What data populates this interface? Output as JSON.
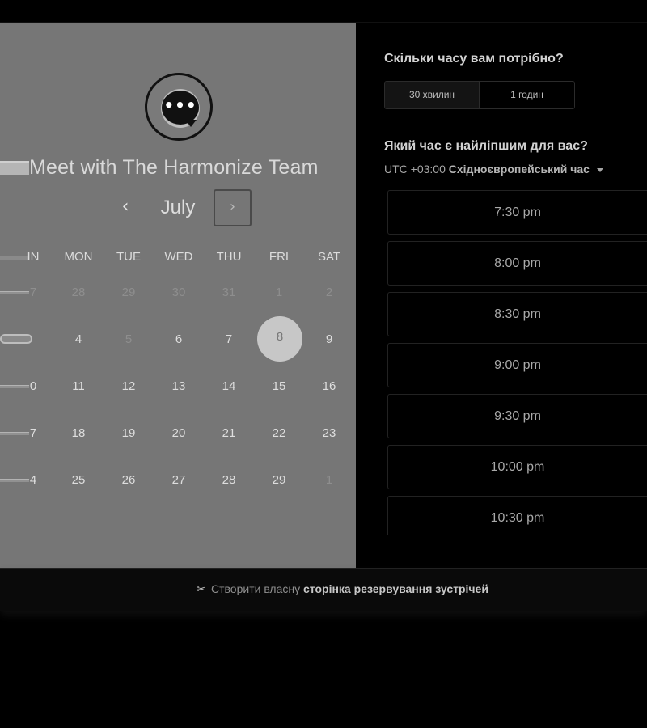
{
  "meeting": {
    "title": "Meet with The Harmonize Team",
    "logo_icon": "chat-bubble-ellipsis-icon"
  },
  "calendar": {
    "month": "July",
    "prev_label": "‹",
    "next_label": "›",
    "weekdays": [
      "SUN",
      "MON",
      "TUE",
      "WED",
      "THU",
      "FRI",
      "SAT"
    ],
    "weekdays_visible": [
      "IN",
      "MON",
      "TUE",
      "WED",
      "THU",
      "FRI",
      "SAT"
    ],
    "rows": [
      [
        "7",
        "28",
        "29",
        "30",
        "31",
        "1",
        "2"
      ],
      [
        "",
        "4",
        "5",
        "6",
        "7",
        "8",
        "9"
      ],
      [
        "0",
        "11",
        "12",
        "13",
        "14",
        "15",
        "16"
      ],
      [
        "7",
        "18",
        "19",
        "20",
        "21",
        "22",
        "23"
      ],
      [
        "4",
        "25",
        "26",
        "27",
        "28",
        "29",
        "1"
      ]
    ],
    "selected_day": "8"
  },
  "duration": {
    "question": "Скільки часу вам потрібно?",
    "options": [
      "30 хвилин",
      "1 годин"
    ],
    "selected": "30 хвилин"
  },
  "time": {
    "question": "Який час є найліпшим для вас?",
    "tz_offset": "UTC +03:00",
    "tz_name": "Східноєвропейський час",
    "slots": [
      "7:30 pm",
      "8:00 pm",
      "8:30 pm",
      "9:00 pm",
      "9:30 pm",
      "10:00 pm",
      "10:30 pm"
    ]
  },
  "footer": {
    "prefix": "Створити власну",
    "link": "сторінка резервування зустрічей",
    "icon": "hubspot-sprocket-icon"
  }
}
